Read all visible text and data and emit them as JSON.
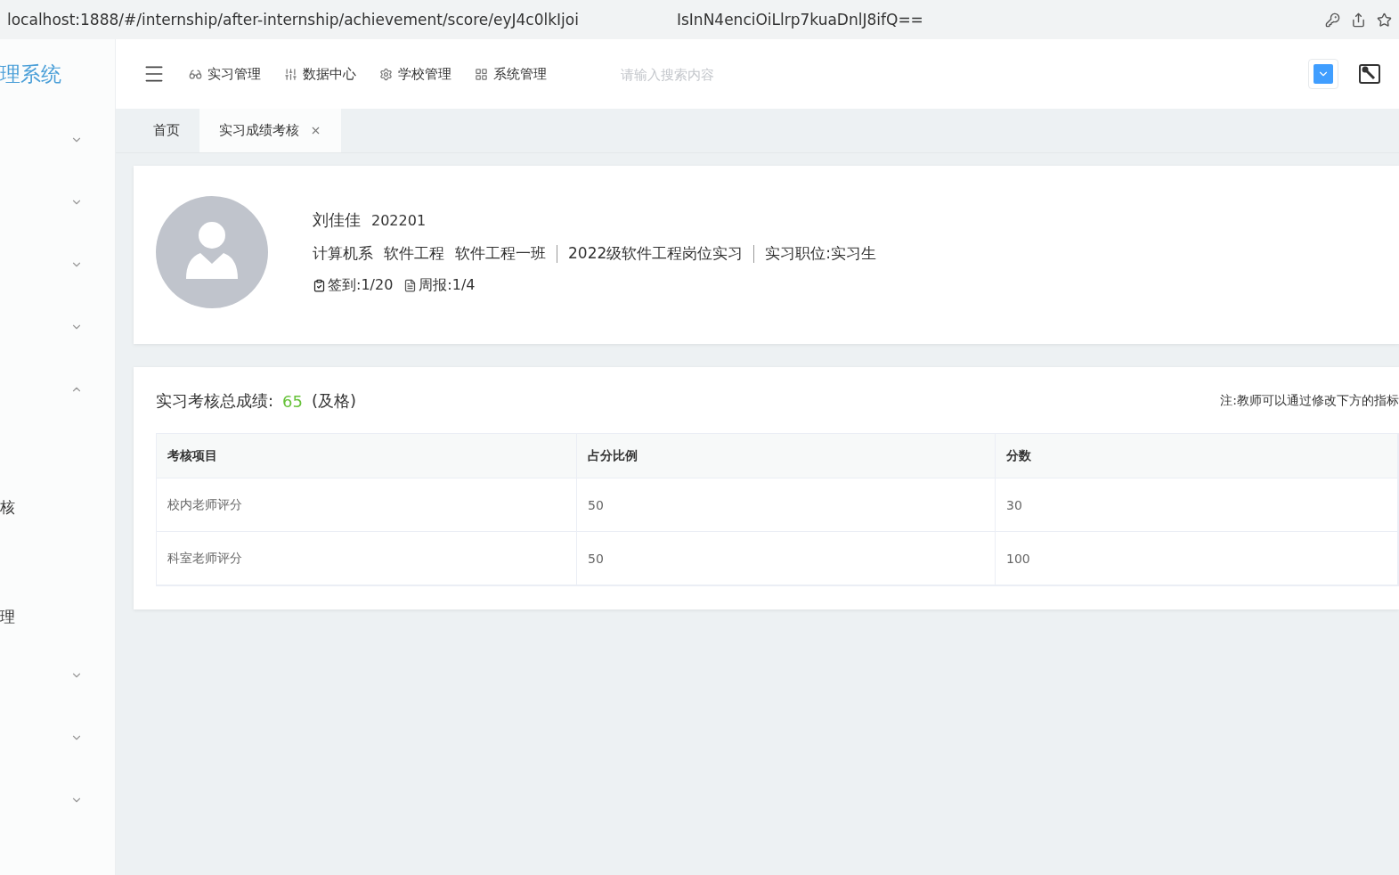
{
  "address_bar": {
    "url_parts": [
      "localhost:1888/#/internship/after-internship/achievement/score/eyJ4c0lkIjoi",
      "IsInN4enciOiLlrp7kuaDnlJ8ifQ=="
    ]
  },
  "sidebar": {
    "title": "理系统",
    "items": [
      {
        "expanded": false
      },
      {
        "expanded": false
      },
      {
        "expanded": false
      },
      {
        "expanded": false
      },
      {
        "expanded": true,
        "children": [
          {
            "label": "核"
          },
          {
            "label": "理"
          }
        ]
      },
      {
        "expanded": false
      },
      {
        "expanded": false
      },
      {
        "expanded": false
      }
    ]
  },
  "top_nav": {
    "items": [
      {
        "kind": "glasses",
        "label": "实习管理"
      },
      {
        "kind": "sliders",
        "label": "数据中心"
      },
      {
        "kind": "gear",
        "label": "学校管理"
      },
      {
        "kind": "grid",
        "label": "系统管理"
      }
    ],
    "search": {
      "placeholder": "请输入搜索内容"
    }
  },
  "tabs": [
    {
      "label": "首页",
      "selected": false,
      "closable": false
    },
    {
      "label": "实习成绩考核",
      "selected": true,
      "closable": true
    }
  ],
  "profile": {
    "name": "刘佳佳",
    "student_id": "202201",
    "info_groups": [
      [
        "计算机系",
        "软件工程",
        "软件工程一班"
      ],
      [
        "2022级软件工程岗位实习"
      ],
      [
        "实习职位:实习生"
      ]
    ],
    "stats": [
      {
        "kind": "checkin",
        "text": "签到:1/20"
      },
      {
        "kind": "report",
        "text": "周报:1/4"
      }
    ]
  },
  "score": {
    "label": "实习考核总成绩:",
    "value": "65",
    "verdict": "(及格)",
    "note": "注:教师可以通过修改下方的指标"
  },
  "table": {
    "columns": [
      "考核项目",
      "占分比例",
      "分数"
    ],
    "rows": [
      [
        "校内老师评分",
        "50",
        "30"
      ],
      [
        "科室老师评分",
        "50",
        "100"
      ]
    ]
  }
}
